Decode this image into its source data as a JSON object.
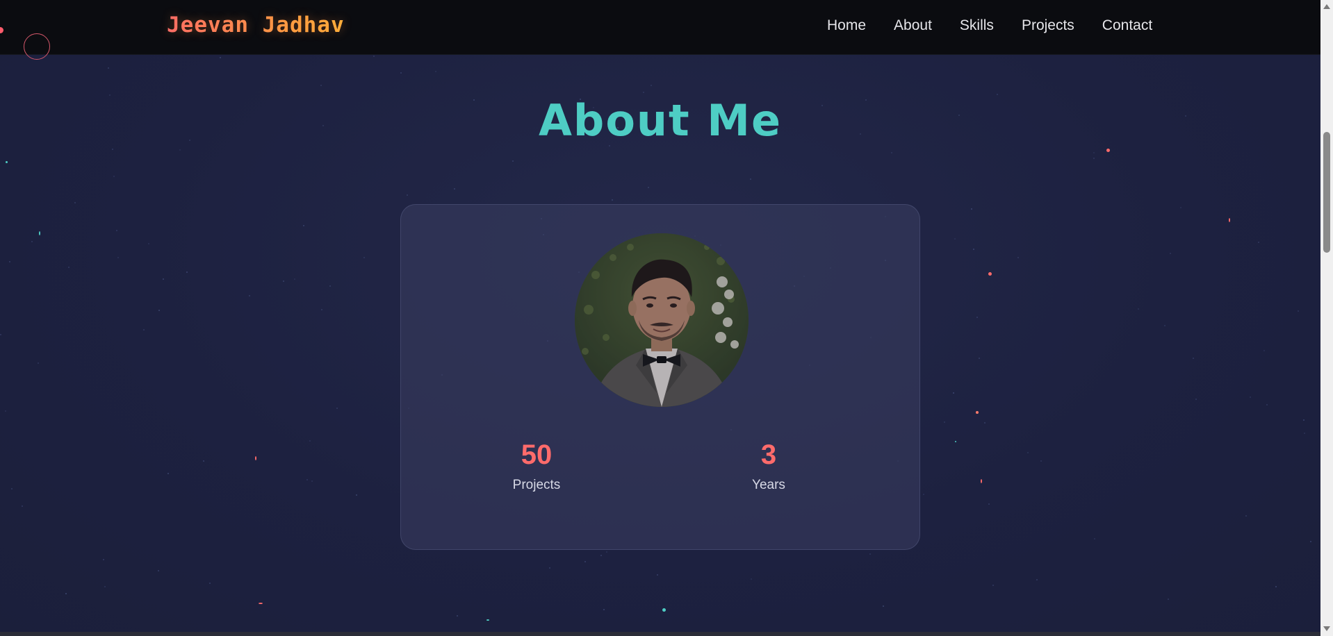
{
  "header": {
    "logo": "Jeevan Jadhav",
    "nav": [
      "Home",
      "About",
      "Skills",
      "Projects",
      "Contact"
    ]
  },
  "about": {
    "title": "About Me",
    "stats": [
      {
        "value": "50",
        "label": "Projects"
      },
      {
        "value": "3",
        "label": "Years"
      }
    ]
  },
  "colors": {
    "accent_teal": "#4ecdc4",
    "accent_coral": "#ff6b6b",
    "logo_gradient_end": "#ff9f43",
    "header_bg": "#0b0c10",
    "page_bg": "#1e2240"
  },
  "icons": {
    "cursor": "cursor-ring-icon",
    "profile": "profile-photo"
  }
}
